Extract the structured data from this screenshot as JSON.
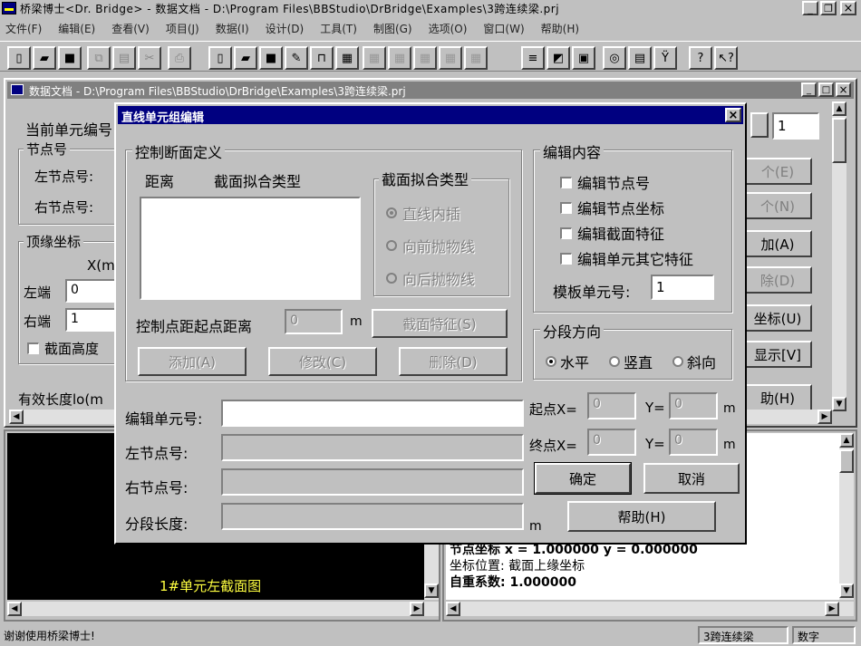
{
  "app": {
    "title": "桥梁博士<Dr. Bridge> - 数据文档 - D:\\Program Files\\BBStudio\\DrBridge\\Examples\\3跨连续梁.prj",
    "title_icon": "bridge-icon"
  },
  "menu": [
    "文件(F)",
    "编辑(E)",
    "查看(V)",
    "项目(J)",
    "数据(I)",
    "设计(D)",
    "工具(T)",
    "制图(G)",
    "选项(O)",
    "窗口(W)",
    "帮助(H)"
  ],
  "window_buttons": {
    "minimize": "_",
    "restore": "❐",
    "close": "×"
  },
  "doc": {
    "title": "数据文档 - D:\\Program Files\\BBStudio\\DrBridge\\Examples\\3跨连续梁.prj",
    "current_unit_label": "当前单元编号",
    "current_unit_value": "1",
    "node_group": "节点号",
    "left_node": "左节点号:",
    "right_node": "右节点号:",
    "top_coord_group": "顶缘坐标",
    "x_label": "X(m",
    "left_end": "左端",
    "left_value": "0",
    "right_end": "右端",
    "right_value": "1",
    "section_height": "截面高度",
    "effective_length": "有效长度lo(m",
    "right_buttons": [
      "个(E)",
      "个(N)",
      "加(A)",
      "除(D)",
      "坐标(U)",
      "显示[V]",
      "助(H)"
    ]
  },
  "section_view": {
    "caption": "1#单元左截面图"
  },
  "info": {
    "lines": [
      "节点坐标 x = 1.000000 y = 0.000000",
      "坐标位置: 截面上缘坐标",
      "自重系数: 1.000000"
    ]
  },
  "status": {
    "message": "谢谢使用桥梁博士!",
    "project": "3跨连续梁",
    "mode": "数字"
  },
  "dialog": {
    "title": "直线单元组编辑",
    "control_group": "控制断面定义",
    "col_distance": "距离",
    "col_fit_type": "截面拟合类型",
    "fit_group": "截面拟合类型",
    "fit_options": [
      "直线内插",
      "向前抛物线",
      "向后抛物线"
    ],
    "ctrl_dist_label": "控制点距起点距离",
    "ctrl_dist_value": "0",
    "unit_m": "m",
    "section_feature_btn": "截面特征(S)",
    "add_btn": "添加(A)",
    "modify_btn": "修改(C)",
    "delete_btn": "删除(D)",
    "edit_group": "编辑内容",
    "edit_options": [
      "编辑节点号",
      "编辑节点坐标",
      "编辑截面特征",
      "编辑单元其它特征"
    ],
    "template_label": "模板单元号:",
    "template_value": "1",
    "direction_group": "分段方向",
    "direction_options": [
      "水平",
      "竖直",
      "斜向"
    ],
    "edit_unit_label": "编辑单元号:",
    "left_node_label": "左节点号:",
    "right_node_label": "右节点号:",
    "seg_len_label": "分段长度:",
    "start_x_label": "起点X=",
    "end_x_label": "终点X=",
    "y_label": "Y=",
    "start_x": "0",
    "start_y": "0",
    "end_x": "0",
    "end_y": "0",
    "ok_btn": "确定",
    "cancel_btn": "取消",
    "help_btn": "帮助(H)",
    "close_glyph": "×"
  }
}
